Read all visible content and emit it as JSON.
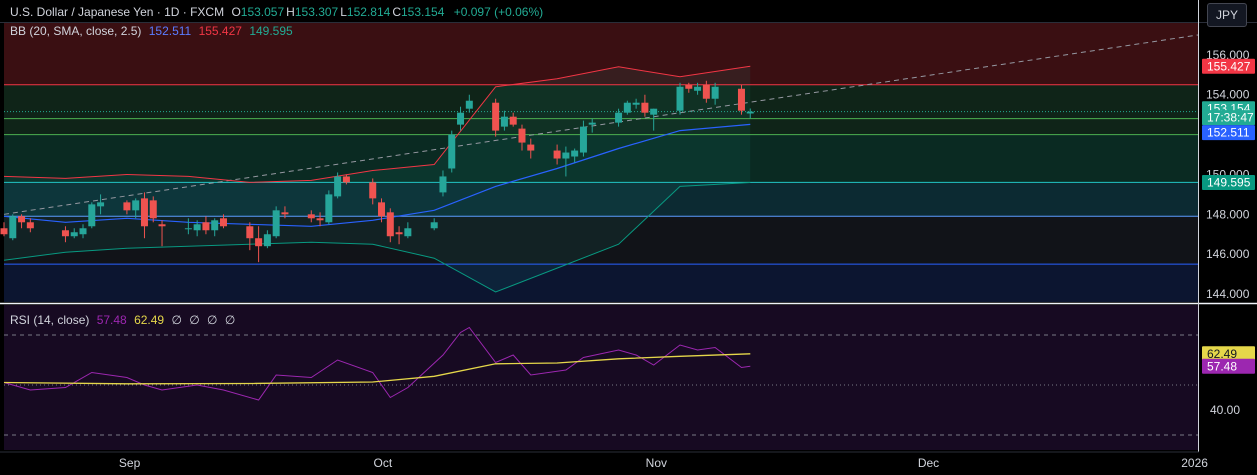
{
  "header": {
    "symbol": "U.S. Dollar / Japanese Yen · 1D · FXCM",
    "ohlc": [
      {
        "label": "O",
        "value": "153.057"
      },
      {
        "label": "H",
        "value": "153.307"
      },
      {
        "label": "L",
        "value": "152.814"
      },
      {
        "label": "C",
        "value": "153.154"
      }
    ],
    "change": "+0.097 (+0.06%)",
    "currency_button": "JPY"
  },
  "bb_legend": {
    "label": "BB (20, SMA, close, 2.5)",
    "basis": "152.511",
    "upper": "155.427",
    "lower": "149.595"
  },
  "rsi_legend": {
    "label": "RSI (14, close)",
    "rsi": "57.48",
    "ma": "62.49",
    "placeholders": [
      "∅",
      "∅",
      "∅",
      "∅"
    ]
  },
  "colors": {
    "up": "#26a69a",
    "down": "#ef5350",
    "bb_upper": "#f23645",
    "bb_basis": "#2962ff",
    "bb_lower": "#089981",
    "rsi_line": "#9c27b0",
    "rsi_ma": "#e5d74a",
    "price_badge": "#22ab94",
    "text_muted": "#b2b5be"
  },
  "chart_data": [
    {
      "type": "candlestick",
      "title": "U.S. Dollar / Japanese Yen · 1D · FXCM",
      "ylim": [
        143.6,
        157.6
      ],
      "y_ticks": [
        "144.000",
        "146.000",
        "148.000",
        "150.000",
        "152.000",
        "154.000",
        "156.000"
      ],
      "x_ticks": [
        {
          "label": "Sep",
          "date": "2024-09-02"
        },
        {
          "label": "Oct",
          "date": "2024-10-01"
        },
        {
          "label": "Nov",
          "date": "2024-11-01"
        },
        {
          "label": "Dec",
          "date": "2024-12-02"
        },
        {
          "label": "2026",
          "date": "2025-01-01"
        }
      ],
      "x_range": [
        "2024-08-19",
        "2025-01-02"
      ],
      "candles": [
        {
          "date": "2024-08-19",
          "o": 147.3,
          "h": 147.6,
          "l": 146.9,
          "c": 147.0
        },
        {
          "date": "2024-08-20",
          "o": 146.8,
          "h": 148.0,
          "l": 146.7,
          "c": 147.9
        },
        {
          "date": "2024-08-21",
          "o": 147.9,
          "h": 148.0,
          "l": 147.3,
          "c": 147.6
        },
        {
          "date": "2024-08-22",
          "o": 147.6,
          "h": 147.8,
          "l": 147.1,
          "c": 147.3
        },
        {
          "date": "2024-08-26",
          "o": 147.2,
          "h": 147.4,
          "l": 146.6,
          "c": 146.9
        },
        {
          "date": "2024-08-27",
          "o": 146.9,
          "h": 147.3,
          "l": 146.8,
          "c": 147.1
        },
        {
          "date": "2024-08-28",
          "o": 147.0,
          "h": 147.5,
          "l": 146.8,
          "c": 147.3
        },
        {
          "date": "2024-08-29",
          "o": 147.4,
          "h": 148.6,
          "l": 147.3,
          "c": 148.5
        },
        {
          "date": "2024-08-30",
          "o": 148.4,
          "h": 149.0,
          "l": 148.0,
          "c": 148.6
        },
        {
          "date": "2024-09-02",
          "o": 148.6,
          "h": 148.7,
          "l": 148.0,
          "c": 148.2
        },
        {
          "date": "2024-09-03",
          "o": 148.2,
          "h": 148.8,
          "l": 147.8,
          "c": 148.7
        },
        {
          "date": "2024-09-04",
          "o": 148.8,
          "h": 149.1,
          "l": 146.8,
          "c": 147.4
        },
        {
          "date": "2024-09-05",
          "o": 148.7,
          "h": 148.9,
          "l": 147.6,
          "c": 147.8
        },
        {
          "date": "2024-09-06",
          "o": 147.5,
          "h": 147.7,
          "l": 146.4,
          "c": 147.4
        },
        {
          "date": "2024-09-09",
          "o": 147.3,
          "h": 147.8,
          "l": 147.0,
          "c": 147.3
        },
        {
          "date": "2024-09-10",
          "o": 147.2,
          "h": 147.7,
          "l": 146.9,
          "c": 147.5
        },
        {
          "date": "2024-09-11",
          "o": 147.6,
          "h": 147.9,
          "l": 147.0,
          "c": 147.2
        },
        {
          "date": "2024-09-12",
          "o": 147.2,
          "h": 147.8,
          "l": 146.9,
          "c": 147.7
        },
        {
          "date": "2024-09-13",
          "o": 147.8,
          "h": 148.0,
          "l": 147.3,
          "c": 147.4
        },
        {
          "date": "2024-09-16",
          "o": 147.4,
          "h": 147.6,
          "l": 146.2,
          "c": 146.8
        },
        {
          "date": "2024-09-17",
          "o": 146.8,
          "h": 147.4,
          "l": 145.6,
          "c": 146.4
        },
        {
          "date": "2024-09-18",
          "o": 146.4,
          "h": 147.2,
          "l": 146.3,
          "c": 147.0
        },
        {
          "date": "2024-09-19",
          "o": 146.9,
          "h": 148.4,
          "l": 146.8,
          "c": 148.2
        },
        {
          "date": "2024-09-20",
          "o": 148.1,
          "h": 148.4,
          "l": 147.8,
          "c": 148.0
        },
        {
          "date": "2024-09-23",
          "o": 148.0,
          "h": 148.2,
          "l": 147.6,
          "c": 147.8
        },
        {
          "date": "2024-09-24",
          "o": 147.8,
          "h": 148.1,
          "l": 147.4,
          "c": 147.7
        },
        {
          "date": "2024-09-25",
          "o": 147.6,
          "h": 149.2,
          "l": 147.5,
          "c": 149.0
        },
        {
          "date": "2024-09-26",
          "o": 148.9,
          "h": 150.1,
          "l": 148.8,
          "c": 149.9
        },
        {
          "date": "2024-09-27",
          "o": 149.9,
          "h": 150.0,
          "l": 149.5,
          "c": 149.6
        },
        {
          "date": "2024-09-30",
          "o": 149.6,
          "h": 149.8,
          "l": 148.5,
          "c": 148.8
        },
        {
          "date": "2024-10-01",
          "o": 148.6,
          "h": 148.8,
          "l": 147.6,
          "c": 147.9
        },
        {
          "date": "2024-10-02",
          "o": 148.1,
          "h": 148.3,
          "l": 146.6,
          "c": 146.9
        },
        {
          "date": "2024-10-03",
          "o": 147.1,
          "h": 147.4,
          "l": 146.5,
          "c": 147.0
        },
        {
          "date": "2024-10-04",
          "o": 146.9,
          "h": 147.6,
          "l": 146.8,
          "c": 147.3
        },
        {
          "date": "2024-10-07",
          "o": 147.3,
          "h": 147.8,
          "l": 147.2,
          "c": 147.6
        },
        {
          "date": "2024-10-08",
          "o": 149.1,
          "h": 150.2,
          "l": 148.9,
          "c": 149.9
        },
        {
          "date": "2024-10-09",
          "o": 150.3,
          "h": 152.2,
          "l": 150.1,
          "c": 152.0
        },
        {
          "date": "2024-10-10",
          "o": 152.5,
          "h": 153.4,
          "l": 152.2,
          "c": 153.1
        },
        {
          "date": "2024-10-11",
          "o": 153.3,
          "h": 154.0,
          "l": 153.1,
          "c": 153.7
        },
        {
          "date": "2024-10-14",
          "o": 153.6,
          "h": 153.8,
          "l": 151.9,
          "c": 152.2
        },
        {
          "date": "2024-10-15",
          "o": 152.4,
          "h": 153.2,
          "l": 152.2,
          "c": 152.9
        },
        {
          "date": "2024-10-16",
          "o": 152.9,
          "h": 153.1,
          "l": 152.4,
          "c": 152.5
        },
        {
          "date": "2024-10-17",
          "o": 152.3,
          "h": 152.5,
          "l": 151.2,
          "c": 151.6
        },
        {
          "date": "2024-10-18",
          "o": 151.5,
          "h": 151.8,
          "l": 150.8,
          "c": 151.2
        },
        {
          "date": "2024-10-21",
          "o": 151.2,
          "h": 151.5,
          "l": 150.5,
          "c": 150.8
        },
        {
          "date": "2024-10-22",
          "o": 150.8,
          "h": 151.4,
          "l": 149.9,
          "c": 151.1
        },
        {
          "date": "2024-10-23",
          "o": 150.9,
          "h": 151.3,
          "l": 150.6,
          "c": 151.2
        },
        {
          "date": "2024-10-24",
          "o": 151.1,
          "h": 152.7,
          "l": 150.9,
          "c": 152.4
        },
        {
          "date": "2024-10-25",
          "o": 152.5,
          "h": 152.8,
          "l": 152.1,
          "c": 152.6
        },
        {
          "date": "2024-10-28",
          "o": 152.6,
          "h": 153.3,
          "l": 152.4,
          "c": 153.1
        },
        {
          "date": "2024-10-29",
          "o": 153.1,
          "h": 153.7,
          "l": 153.0,
          "c": 153.6
        },
        {
          "date": "2024-10-30",
          "o": 153.5,
          "h": 153.8,
          "l": 153.3,
          "c": 153.6
        },
        {
          "date": "2024-10-31",
          "o": 153.6,
          "h": 154.0,
          "l": 152.9,
          "c": 153.1
        },
        {
          "date": "2024-11-01",
          "o": 153.0,
          "h": 153.3,
          "l": 152.2,
          "c": 153.3
        },
        {
          "date": "2024-11-04",
          "o": 153.2,
          "h": 154.6,
          "l": 153.0,
          "c": 154.4
        },
        {
          "date": "2024-11-05",
          "o": 154.5,
          "h": 154.6,
          "l": 154.1,
          "c": 154.3
        },
        {
          "date": "2024-11-06",
          "o": 154.2,
          "h": 154.6,
          "l": 154.0,
          "c": 154.4
        },
        {
          "date": "2024-11-07",
          "o": 154.5,
          "h": 154.7,
          "l": 153.6,
          "c": 153.8
        },
        {
          "date": "2024-11-08",
          "o": 153.8,
          "h": 154.6,
          "l": 153.5,
          "c": 154.4
        },
        {
          "date": "2024-11-11",
          "o": 154.3,
          "h": 154.5,
          "l": 153.0,
          "c": 153.2
        },
        {
          "date": "2024-11-12",
          "o": 153.06,
          "h": 153.31,
          "l": 152.81,
          "c": 153.15
        }
      ],
      "bollinger": {
        "basis": [
          [
            "2024-08-19",
            147.9
          ],
          [
            "2024-08-26",
            147.6
          ],
          [
            "2024-09-02",
            147.8
          ],
          [
            "2024-09-09",
            147.6
          ],
          [
            "2024-09-16",
            147.5
          ],
          [
            "2024-09-23",
            147.4
          ],
          [
            "2024-09-30",
            147.7
          ],
          [
            "2024-10-07",
            148.2
          ],
          [
            "2024-10-14",
            149.4
          ],
          [
            "2024-10-21",
            150.3
          ],
          [
            "2024-10-28",
            151.3
          ],
          [
            "2024-11-04",
            152.2
          ],
          [
            "2024-11-12",
            152.511
          ]
        ],
        "upper": [
          [
            "2024-08-19",
            149.9
          ],
          [
            "2024-08-26",
            149.8
          ],
          [
            "2024-09-02",
            150.0
          ],
          [
            "2024-09-09",
            149.9
          ],
          [
            "2024-09-16",
            149.6
          ],
          [
            "2024-09-23",
            149.7
          ],
          [
            "2024-09-30",
            150.2
          ],
          [
            "2024-10-07",
            150.5
          ],
          [
            "2024-10-14",
            154.4
          ],
          [
            "2024-10-21",
            154.8
          ],
          [
            "2024-10-28",
            155.4
          ],
          [
            "2024-11-04",
            154.9
          ],
          [
            "2024-11-12",
            155.427
          ]
        ],
        "lower": [
          [
            "2024-08-19",
            145.7
          ],
          [
            "2024-08-26",
            146.1
          ],
          [
            "2024-09-02",
            146.3
          ],
          [
            "2024-09-09",
            146.4
          ],
          [
            "2024-09-16",
            146.5
          ],
          [
            "2024-09-23",
            146.6
          ],
          [
            "2024-09-30",
            146.5
          ],
          [
            "2024-10-07",
            145.8
          ],
          [
            "2024-10-14",
            144.1
          ],
          [
            "2024-10-21",
            145.3
          ],
          [
            "2024-10-28",
            146.5
          ],
          [
            "2024-11-04",
            149.4
          ],
          [
            "2024-11-12",
            149.595
          ]
        ]
      },
      "zones": [
        {
          "from": 154.5,
          "to": 157.6,
          "color": "#3a0f12"
        },
        {
          "from": 152.0,
          "to": 154.5,
          "color": "#0f2418"
        },
        {
          "from": 149.6,
          "to": 152.0,
          "color": "#0a2a22"
        },
        {
          "from": 147.9,
          "to": 149.6,
          "color": "#0c2a32"
        },
        {
          "from": 145.5,
          "to": 147.9,
          "color": "#111318"
        },
        {
          "from": 143.6,
          "to": 145.5,
          "color": "#0c1530"
        }
      ],
      "horizontal_lines": [
        {
          "y": 154.5,
          "color": "#f23645"
        },
        {
          "y": 152.8,
          "color": "#4caf50"
        },
        {
          "y": 152.0,
          "color": "#4caf50"
        },
        {
          "y": 149.6,
          "color": "#22c5c5"
        },
        {
          "y": 147.9,
          "color": "#5b9cff"
        },
        {
          "y": 145.5,
          "color": "#2962ff"
        }
      ],
      "trendline": {
        "from": [
          "2024-08-19",
          148.0
        ],
        "to": [
          "2025-01-02",
          157.0
        ]
      },
      "price_labels": [
        {
          "value": "155.427",
          "color": "#f23645",
          "y": 155.427
        },
        {
          "value": "153.154",
          "color": "#22ab94",
          "y": 153.3
        },
        {
          "value": "17:38:47",
          "color": "#22ab94",
          "y": 152.85
        },
        {
          "value": "152.511",
          "color": "#2962ff",
          "y": 152.1
        },
        {
          "value": "149.595",
          "color": "#089981",
          "y": 149.595
        }
      ]
    },
    {
      "type": "line",
      "title": "RSI (14, close)",
      "ylim": [
        24,
        82
      ],
      "y_ticks": [
        "40.00"
      ],
      "levels": [
        70,
        50,
        30
      ],
      "x_range": [
        "2024-08-19",
        "2025-01-02"
      ],
      "series": [
        {
          "name": "RSI",
          "color": "#9c27b0",
          "points": [
            [
              "2024-08-19",
              51
            ],
            [
              "2024-08-22",
              48
            ],
            [
              "2024-08-26",
              49
            ],
            [
              "2024-08-29",
              55
            ],
            [
              "2024-09-02",
              53
            ],
            [
              "2024-09-04",
              50
            ],
            [
              "2024-09-06",
              48
            ],
            [
              "2024-09-10",
              50
            ],
            [
              "2024-09-13",
              48
            ],
            [
              "2024-09-17",
              44
            ],
            [
              "2024-09-19",
              54
            ],
            [
              "2024-09-23",
              53
            ],
            [
              "2024-09-26",
              60
            ],
            [
              "2024-09-30",
              55
            ],
            [
              "2024-10-02",
              45
            ],
            [
              "2024-10-04",
              49
            ],
            [
              "2024-10-08",
              62
            ],
            [
              "2024-10-10",
              71
            ],
            [
              "2024-10-11",
              73
            ],
            [
              "2024-10-14",
              59
            ],
            [
              "2024-10-16",
              62
            ],
            [
              "2024-10-18",
              54
            ],
            [
              "2024-10-22",
              56
            ],
            [
              "2024-10-24",
              61
            ],
            [
              "2024-10-28",
              64
            ],
            [
              "2024-10-30",
              62
            ],
            [
              "2024-11-01",
              58
            ],
            [
              "2024-11-04",
              66
            ],
            [
              "2024-11-06",
              64
            ],
            [
              "2024-11-08",
              65
            ],
            [
              "2024-11-11",
              57
            ],
            [
              "2024-11-12",
              57.48
            ]
          ]
        },
        {
          "name": "RSI-based MA",
          "color": "#e5d74a",
          "points": [
            [
              "2024-08-19",
              51
            ],
            [
              "2024-09-02",
              50.5
            ],
            [
              "2024-09-16",
              50.6
            ],
            [
              "2024-09-30",
              51.2
            ],
            [
              "2024-10-07",
              53.5
            ],
            [
              "2024-10-14",
              58.5
            ],
            [
              "2024-10-21",
              58.8
            ],
            [
              "2024-10-28",
              60.5
            ],
            [
              "2024-11-04",
              61.5
            ],
            [
              "2024-11-12",
              62.49
            ]
          ]
        }
      ],
      "price_labels": [
        {
          "value": "62.49",
          "color": "#e5d74a",
          "y": 62.49
        },
        {
          "value": "57.48",
          "color": "#9c27b0",
          "y": 57.48
        }
      ]
    }
  ]
}
